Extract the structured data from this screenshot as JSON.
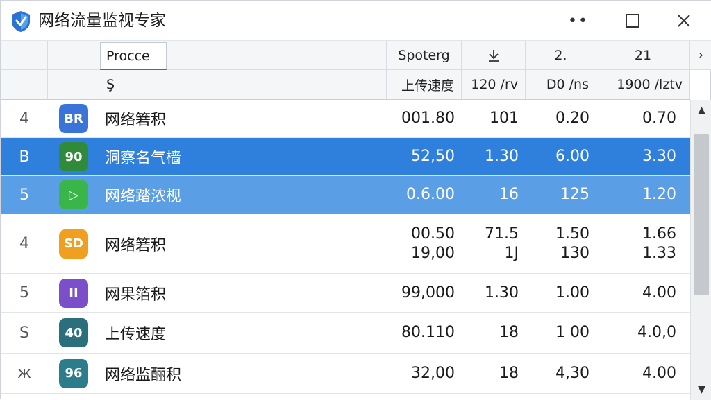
{
  "window": {
    "title": "网络流量监视专家",
    "dots_label": "••"
  },
  "header": {
    "row1": {
      "process_edit": "Procce",
      "col_v1": "Spoterg",
      "col_v2_icon": "download-arrow-icon",
      "col_v3": "2.",
      "col_v4": "21",
      "more": "›"
    },
    "row2": {
      "col_name": "Ş",
      "col_v1": "上传速度",
      "col_v2": "120 /rv",
      "col_v3": "D0 /ns",
      "col_v4": "1900 /lztv"
    }
  },
  "rows": [
    {
      "id": "4",
      "icon_text": "BR",
      "icon_color": "#3b74d8",
      "name": "网络箬积",
      "v1": [
        "001.80"
      ],
      "v2": [
        "101"
      ],
      "v3": [
        "0.20"
      ],
      "v4": [
        "0.70"
      ]
    },
    {
      "id": "B",
      "icon_text": "90",
      "icon_color": "#2f8a3a",
      "name": "洞察名气樯",
      "v1": [
        "52,50"
      ],
      "v2": [
        "1.30"
      ],
      "v3": [
        "6.00"
      ],
      "v4": [
        "3.30"
      ]
    },
    {
      "id": "5",
      "icon_text": "▷",
      "icon_color": "#39b54a",
      "name": "网络踏浓枧",
      "v1": [
        "0.6.00"
      ],
      "v2": [
        "16"
      ],
      "v3": [
        "125"
      ],
      "v4": [
        "1.20"
      ]
    },
    {
      "id": "4",
      "icon_text": "SD",
      "icon_color": "#f0a020",
      "name": "网络箬积",
      "v1": [
        "00.50",
        "19,00"
      ],
      "v2": [
        "71.5",
        "1J"
      ],
      "v3": [
        "1.50",
        "130"
      ],
      "v4": [
        "1.66",
        "1.33"
      ]
    },
    {
      "id": "5",
      "icon_text": "II",
      "icon_color": "#7b4fc9",
      "name": "网果箔积",
      "v1": [
        "99,000"
      ],
      "v2": [
        "1.30"
      ],
      "v3": [
        "1.00"
      ],
      "v4": [
        "4.00"
      ]
    },
    {
      "id": "S",
      "icon_text": "40",
      "icon_color": "#2b6f7d",
      "name": "上传速度",
      "v1": [
        "80.110"
      ],
      "v2": [
        "18"
      ],
      "v3": [
        "1 00"
      ],
      "v4": [
        "4.0,0"
      ]
    },
    {
      "id": "ж",
      "icon_text": "96",
      "icon_color": "#2c7d8c",
      "name": "网络监酾积",
      "v1": [
        "32,00"
      ],
      "v2": [
        "18"
      ],
      "v3": [
        "4,30"
      ],
      "v4": [
        "4.00"
      ]
    }
  ],
  "scrollbar": {
    "up": "▲",
    "down": "▼"
  }
}
